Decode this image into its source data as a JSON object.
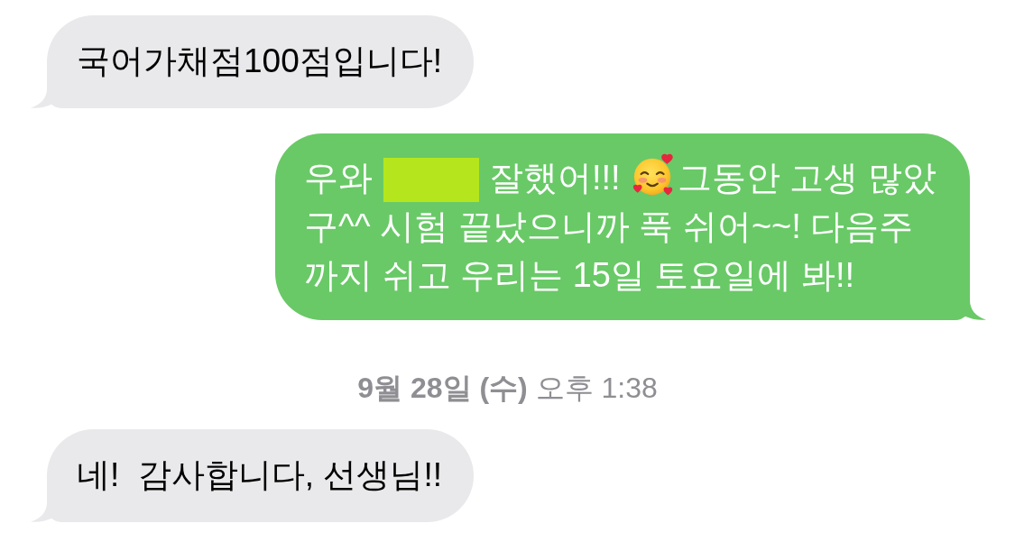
{
  "messages": [
    {
      "kind": "received",
      "text": "국어가채점100점입니다!"
    },
    {
      "kind": "sent",
      "lines": [
        {
          "parts": [
            {
              "kind": "text",
              "text": "우와"
            },
            {
              "kind": "redaction"
            },
            {
              "kind": "text",
              "text": "잘했어!!!"
            },
            {
              "kind": "emoji"
            },
            {
              "kind": "text",
              "text": "그동안 고생 많았"
            }
          ]
        },
        {
          "parts": [
            {
              "kind": "text",
              "text": "구^^ 시험 끝났으니까 푹 쉬어~~! 다음주"
            }
          ]
        },
        {
          "parts": [
            {
              "kind": "text",
              "text": "까지 쉬고 우리는 15일 토요일에 봐!!"
            }
          ]
        }
      ]
    },
    {
      "kind": "timestamp",
      "text": "**9월 28일 (수)** 오후 1:38"
    },
    {
      "kind": "received",
      "text": "네!  감사합니다, 선생님!!"
    }
  ]
}
